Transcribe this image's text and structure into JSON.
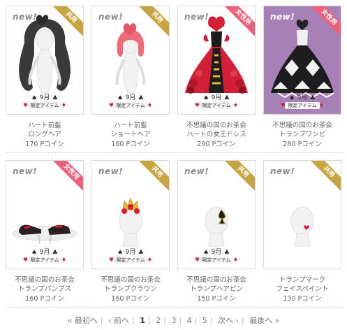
{
  "items": [
    {
      "new_label": "new!",
      "ribbon": "共用",
      "ribbon_color": "#c9a542",
      "name_line1": "ハート前髪",
      "name_line2": "ロングヘア",
      "price": "170 Pコイン",
      "limited_month": "9月",
      "limited_text": "限定アイテム",
      "background": "#ffffff",
      "icon": "long-hair-avatar-icon"
    },
    {
      "new_label": "new!",
      "ribbon": "共用",
      "ribbon_color": "#c9a542",
      "name_line1": "ハート前髪",
      "name_line2": "ショートヘア",
      "price": "160 Pコイン",
      "limited_month": "9月",
      "limited_text": "限定アイテム",
      "background": "#ffffff",
      "icon": "short-hair-avatar-icon"
    },
    {
      "new_label": "new!",
      "ribbon": "女性用",
      "ribbon_color": "#f0607a",
      "name_line1": "不思議の国のお茶会",
      "name_line2": "ハートの女王ドレス",
      "price": "290 Pコイン",
      "limited_month": "9月",
      "limited_text": "限定アイテム",
      "background": "#ffffff",
      "icon": "queen-dress-icon"
    },
    {
      "new_label": "new!",
      "ribbon": "女性用",
      "ribbon_color": "#f0607a",
      "name_line1": "不思議の国のお茶会",
      "name_line2": "トランプワンピ",
      "price": "280 Pコイン",
      "limited_month": "9月",
      "limited_text": "限定アイテム",
      "background": "#a780b8",
      "icon": "card-dress-icon"
    },
    {
      "new_label": "new!",
      "ribbon": "女性用",
      "ribbon_color": "#f0607a",
      "name_line1": "不思議の国のお茶会",
      "name_line2": "トランプパンプス",
      "price": "160 Pコイン",
      "limited_month": "9月",
      "limited_text": "限定アイテム",
      "background": "#ffffff",
      "icon": "pumps-icon"
    },
    {
      "new_label": "new!",
      "ribbon": "共用",
      "ribbon_color": "#c9a542",
      "name_line1": "不思議の国のお茶会",
      "name_line2": "トランプクラウン",
      "price": "160 Pコイン",
      "limited_month": "9月",
      "limited_text": "限定アイテム",
      "background": "#ffffff",
      "icon": "crown-icon"
    },
    {
      "new_label": "new!",
      "ribbon": "共用",
      "ribbon_color": "#c9a542",
      "name_line1": "不思議の国のお茶会",
      "name_line2": "トランプヘアピン",
      "price": "150 Pコイン",
      "limited_month": "9月",
      "limited_text": "限定アイテム",
      "background": "#ffffff",
      "icon": "spade-hairpin-icon"
    },
    {
      "new_label": "new!",
      "ribbon": "共用",
      "ribbon_color": "#c9a542",
      "name_line1": "トランプマーク",
      "name_line2": "フェイスペイント",
      "price": "130 Pコイン",
      "limited_month": "",
      "limited_text": "",
      "background": "#ffffff",
      "icon": "face-paint-icon"
    }
  ],
  "pager": {
    "first": "« 最初へ",
    "prev": "‹ 前へ",
    "pages": [
      "1",
      "2",
      "3",
      "4",
      "5"
    ],
    "current": "1",
    "next": "次へ ›",
    "last": "最後へ »"
  }
}
